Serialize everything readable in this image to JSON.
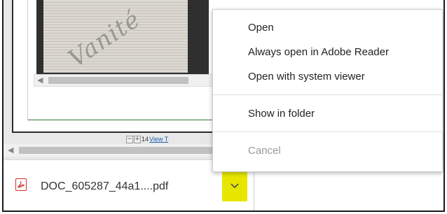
{
  "viewer": {
    "page_number": "14",
    "view_link": "View T",
    "zoom_out_symbol": "−",
    "zoom_in_symbol": "+",
    "document_scan_text": "Vanité",
    "scroll_left_arrow": "◀"
  },
  "context_menu": {
    "items": [
      {
        "label": "Open",
        "enabled": true
      },
      {
        "label": "Always open in Adobe Reader",
        "enabled": true
      },
      {
        "label": "Open with system viewer",
        "enabled": true
      },
      {
        "label": "Show in folder",
        "enabled": true
      },
      {
        "label": "Cancel",
        "enabled": false
      }
    ]
  },
  "download_bar": {
    "file_name": "DOC_605287_44a1....pdf",
    "file_icon": "pdf-file-icon",
    "menu_icon": "chevron-down-icon",
    "highlight_color": "#e6e600"
  },
  "colors": {
    "pdf_icon": "#d32f2f",
    "link": "#1a5fb4",
    "disabled_text": "#9a9a9a"
  }
}
